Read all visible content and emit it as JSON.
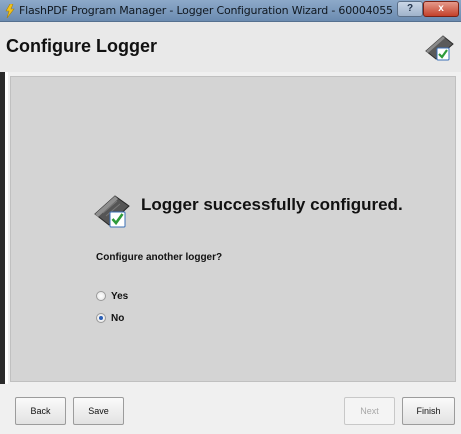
{
  "window": {
    "title": "FlashPDF Program Manager - Logger Configuration Wizard - 60004055",
    "help_label": "?",
    "close_label": "x"
  },
  "header": {
    "title": "Configure Logger",
    "icon": "logger-icon"
  },
  "content": {
    "success_message": "Logger successfully configured.",
    "success_icon": "logger-check-icon",
    "question": "Configure another logger?",
    "options": [
      {
        "label": "Yes",
        "selected": false
      },
      {
        "label": "No",
        "selected": true
      }
    ]
  },
  "footer": {
    "back_label": "Back",
    "save_label": "Save",
    "next_label": "Next",
    "next_enabled": false,
    "finish_label": "Finish"
  },
  "colors": {
    "title_bar": "#7b9abd",
    "close_button": "#c4412a",
    "panel_bg": "#d4d4d4",
    "checkmark": "#2e9b3a"
  }
}
